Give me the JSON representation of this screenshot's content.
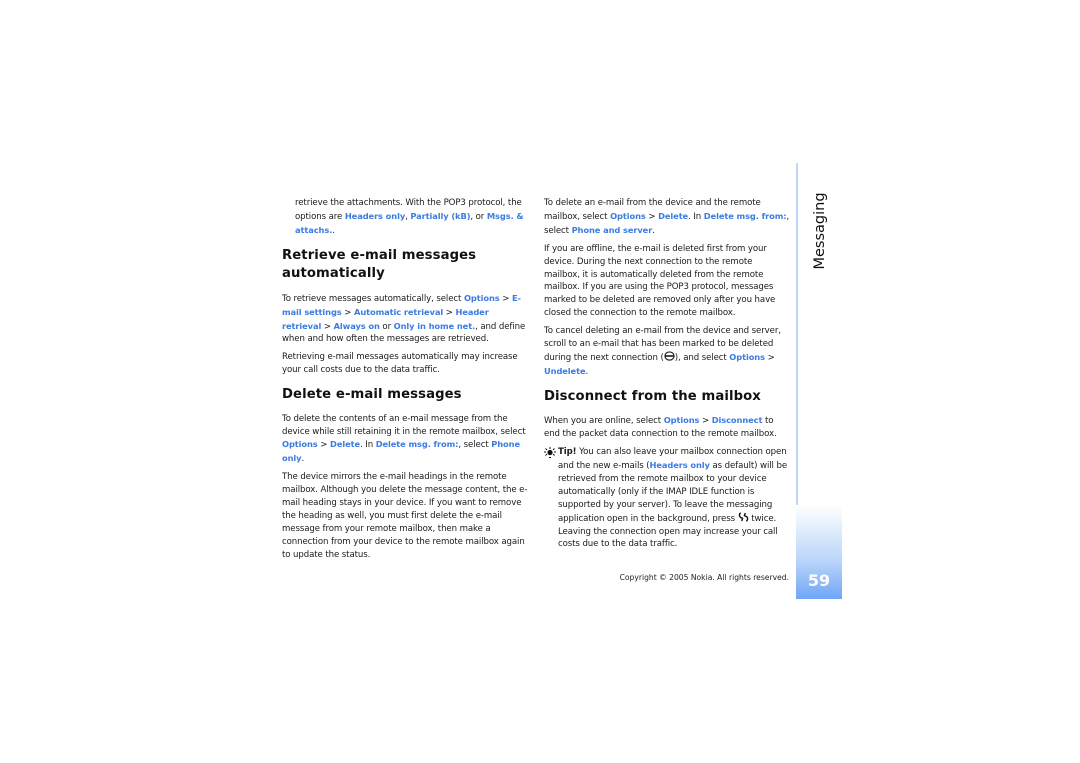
{
  "section_title": "Messaging",
  "page_number": "59",
  "copyright": "Copyright © 2005 Nokia. All rights reserved.",
  "accent_color": "#3b7ce2",
  "left_column": {
    "intro": {
      "t1": "retrieve the attachments. With the POP3 protocol, the options are ",
      "l1": "Headers only",
      "t2": ", ",
      "l2": "Partially (kB)",
      "t3": ", or ",
      "l3": "Msgs. & attachs.",
      "t4": "."
    },
    "heading_retrieve": "Retrieve e-mail messages automatically",
    "retrieve_p1": {
      "t1": "To retrieve messages automatically, select ",
      "l1": "Options",
      "t2": " > ",
      "l2": "E-mail settings",
      "t3": " > ",
      "l3": "Automatic retrieval",
      "t4": " > ",
      "l4": "Header retrieval",
      "t5": " > ",
      "l5": "Always on",
      "t6": " or ",
      "l6": "Only in home net.",
      "t7": ", and define when and how often the messages are retrieved."
    },
    "retrieve_p2": "Retrieving e-mail messages automatically may increase your call costs due to the data traffic.",
    "heading_delete": "Delete e-mail messages",
    "delete_p1": {
      "t1": "To delete the contents of an e-mail message from the device while still retaining it in the remote mailbox, select ",
      "l1": "Options",
      "t2": " > ",
      "l2": "Delete",
      "t3": ". In ",
      "l3": "Delete msg. from:",
      "t4": ", select ",
      "l4": "Phone only",
      "t5": "."
    },
    "delete_p2": "The device mirrors the e-mail headings in the remote mailbox. Although you delete the message content, the e-mail heading stays in your device. If you want to remove the heading as well, you must first delete the e-mail message from your remote mailbox, then make a connection from your device to the remote mailbox again to update the status."
  },
  "right_column": {
    "delete_p3": {
      "t1": "To delete an e-mail from the device and the remote mailbox, select ",
      "l1": "Options",
      "t2": " > ",
      "l2": "Delete",
      "t3": ". In ",
      "l3": "Delete msg. from:",
      "t4": ", select ",
      "l4": "Phone and server",
      "t5": "."
    },
    "offline_p": "If you are offline, the e-mail is deleted first from your device. During the next connection to the remote mailbox, it is automatically deleted from the remote mailbox. If you are using the POP3 protocol, messages marked to be deleted are removed only after you have closed the connection to the remote mailbox.",
    "cancel_p": {
      "t1": "To cancel deleting an e-mail from the device and server, scroll to an e-mail that has been marked to be deleted during the next connection (",
      "icon": "marked-for-deletion-icon",
      "t2": "), and select ",
      "l1": "Options",
      "t3": " > ",
      "l2": "Undelete",
      "t4": "."
    },
    "heading_disconnect": "Disconnect from the mailbox",
    "disconnect_p": {
      "t1": "When you are online, select ",
      "l1": "Options",
      "t2": " > ",
      "l2": "Disconnect",
      "t3": " to end the packet data connection to the remote mailbox."
    },
    "tip": {
      "icon": "tip-lightbulb-icon",
      "label": "Tip!",
      "t1": " You can also leave your mailbox connection open and the new e-mails (",
      "l1": "Headers only",
      "t2": " as default) will be retrieved from the remote mailbox to your device automatically (only if the IMAP IDLE function is supported by your server). To leave the messaging application open in the background, press ",
      "key_icon": "menu-key-icon",
      "t3": " twice. Leaving the connection open may increase your call costs due to the data traffic."
    }
  }
}
